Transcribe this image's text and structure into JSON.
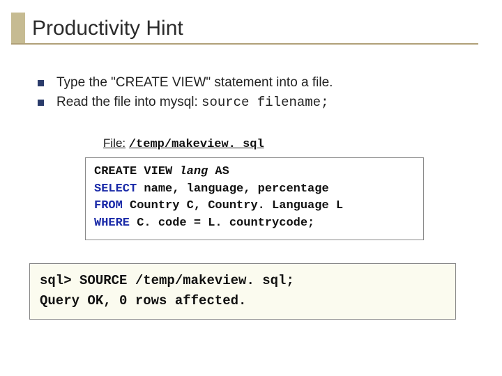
{
  "title": "Productivity Hint",
  "bullets": [
    {
      "pre": "Type the \"CREATE VIEW\" statement into a file."
    },
    {
      "pre": "Read the file into mysql: ",
      "code": "source filename;"
    }
  ],
  "file_label": "File:",
  "file_path": "/temp/makeview. sql",
  "code1": {
    "l1a": "CREATE VIEW ",
    "l1b": "lang",
    "l1c": " AS",
    "l2a": "SELECT",
    "l2b": " name, language, percentage",
    "l3a": "FROM",
    "l3b": " Country C, Country. Language L",
    "l4a": "WHERE",
    "l4b": " C. code = L. countrycode;"
  },
  "code2": {
    "l1": "sql> SOURCE /temp/makeview. sql;",
    "l2": "Query OK, 0 rows affected."
  }
}
